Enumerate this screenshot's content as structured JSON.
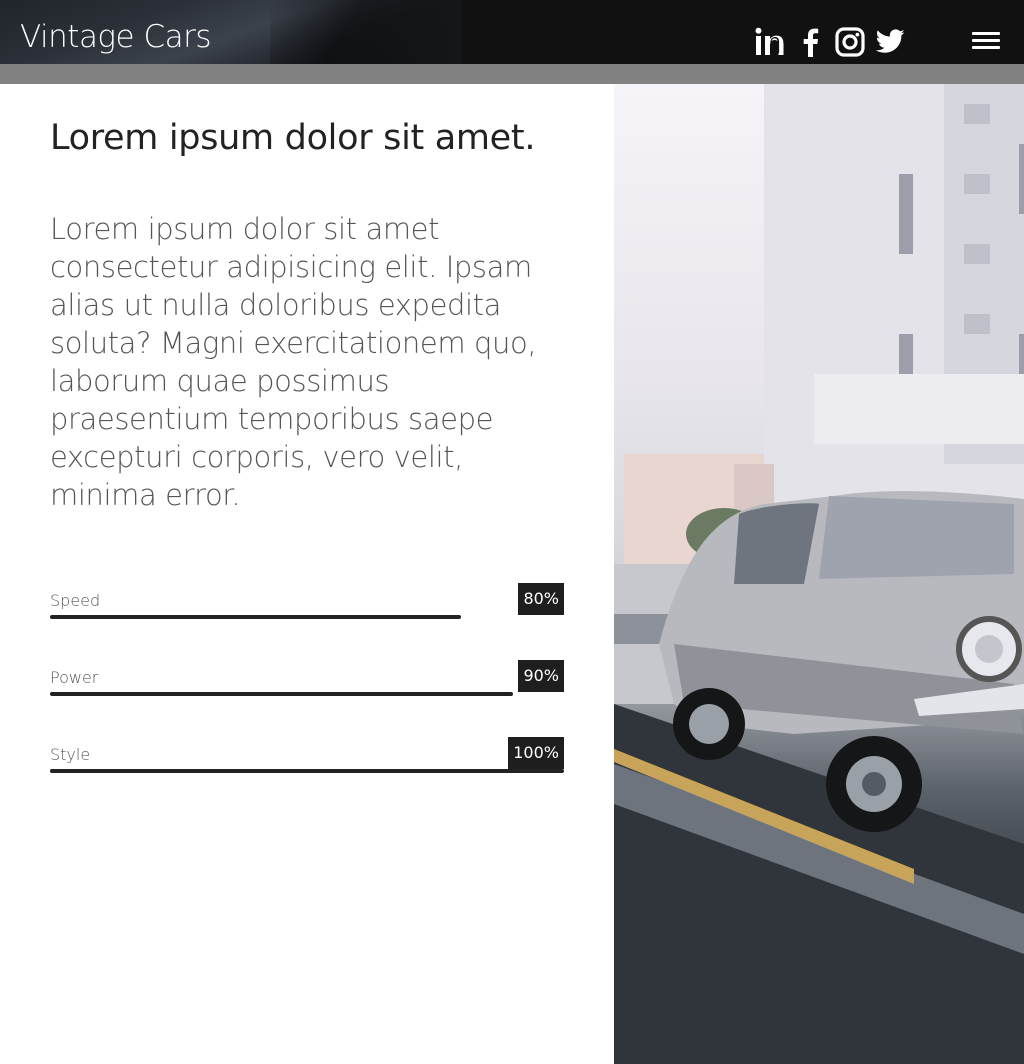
{
  "header": {
    "brand": "Vintage Cars",
    "social": [
      "linkedin-icon",
      "facebook-icon",
      "instagram-icon",
      "twitter-icon"
    ],
    "menu_icon": "hamburger-menu-icon"
  },
  "main": {
    "headline": "Lorem ipsum dolor sit amet.",
    "lead": "Lorem ipsum dolor sit amet consectetur adipisicing elit. Ipsam alias ut nulla doloribus expedita soluta? Magni exercitationem quo, laborum quae possimus praesentium temporibus saepe excepturi corporis, vero velit, minima error."
  },
  "skills": [
    {
      "label": "Speed",
      "value_text": "80%",
      "value": 0.8
    },
    {
      "label": "Power",
      "value_text": "90%",
      "value": 0.9
    },
    {
      "label": "Style",
      "value_text": "100%",
      "value": 1.0
    }
  ],
  "colors": {
    "header_bg": "#111111",
    "strip": "#828282",
    "bar": "#222222",
    "badge": "#1e1e1e"
  }
}
